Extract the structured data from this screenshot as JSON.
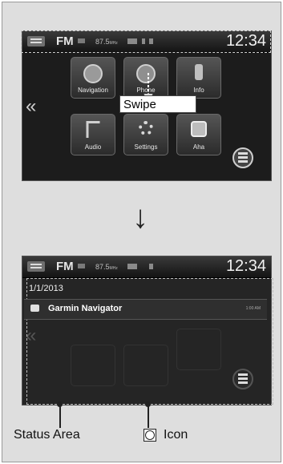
{
  "screen1": {
    "status": {
      "band": "FM",
      "freq": "87.5",
      "freq_unit": "MHz",
      "time": "12:34"
    },
    "tiles": [
      {
        "label": "Navigation",
        "icon": "navigation-icon"
      },
      {
        "label": "Phone",
        "icon": "phone-icon"
      },
      {
        "label": "Info",
        "icon": "info-icon"
      },
      {
        "label": "Audio",
        "icon": "audio-icon"
      },
      {
        "label": "Settings",
        "icon": "settings-icon"
      },
      {
        "label": "Aha",
        "icon": "aha-icon"
      }
    ],
    "swipe_label": "Swipe"
  },
  "screen2": {
    "status": {
      "band": "FM",
      "freq": "87.5",
      "freq_unit": "MHz",
      "time": "12:34"
    },
    "date": "1/1/2013",
    "notification": {
      "title": "Garmin Navigator",
      "time": "1:00 AM"
    }
  },
  "callouts": {
    "status_area": "Status Area",
    "icon": "Icon"
  }
}
